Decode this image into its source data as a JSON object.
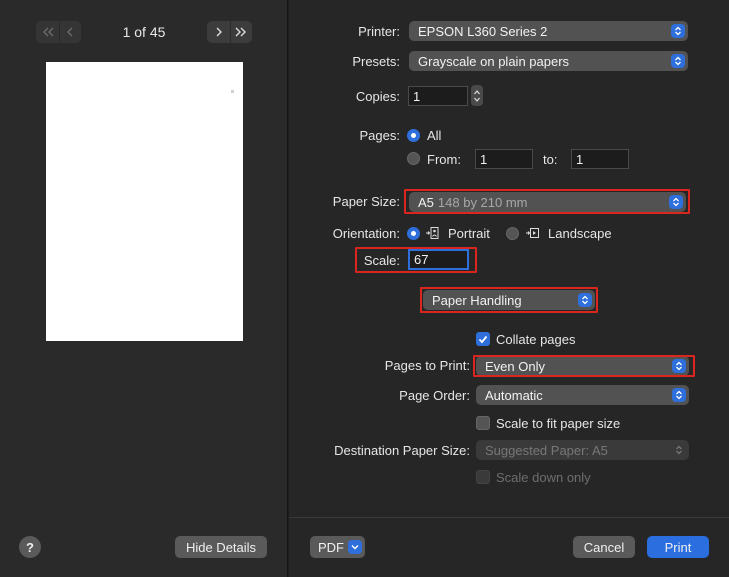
{
  "preview": {
    "page_counter": "1 of 45",
    "hide_details_label": "Hide Details",
    "help_label": "?"
  },
  "printer": {
    "label": "Printer:",
    "value": "EPSON L360 Series 2"
  },
  "presets": {
    "label": "Presets:",
    "value": "Grayscale on plain papers"
  },
  "copies": {
    "label": "Copies:",
    "value": "1"
  },
  "pages": {
    "label": "Pages:",
    "all_label": "All",
    "from_label": "From:",
    "from_value": "1",
    "to_label": "to:",
    "to_value": "1",
    "selected": "All"
  },
  "paper_size": {
    "label": "Paper Size:",
    "name": "A5",
    "dims": "148 by 210 mm"
  },
  "orientation": {
    "label": "Orientation:",
    "portrait_label": "Portrait",
    "landscape_label": "Landscape",
    "selected": "Portrait"
  },
  "scale": {
    "label": "Scale:",
    "value": "67"
  },
  "section_menu": {
    "value": "Paper Handling"
  },
  "collate": {
    "label": "Collate pages",
    "checked": true
  },
  "pages_to_print": {
    "label": "Pages to Print:",
    "value": "Even Only"
  },
  "page_order": {
    "label": "Page Order:",
    "value": "Automatic"
  },
  "scale_to_fit": {
    "label": "Scale to fit paper size",
    "checked": false
  },
  "destination_paper_size": {
    "label": "Destination Paper Size:",
    "value": "Suggested Paper: A5"
  },
  "scale_down_only": {
    "label": "Scale down only",
    "checked": false
  },
  "footer": {
    "pdf_label": "PDF",
    "cancel_label": "Cancel",
    "print_label": "Print"
  },
  "colors": {
    "accent": "#2f6fdc",
    "highlight": "#d9261f",
    "primary_button": "#2a6ee0"
  }
}
